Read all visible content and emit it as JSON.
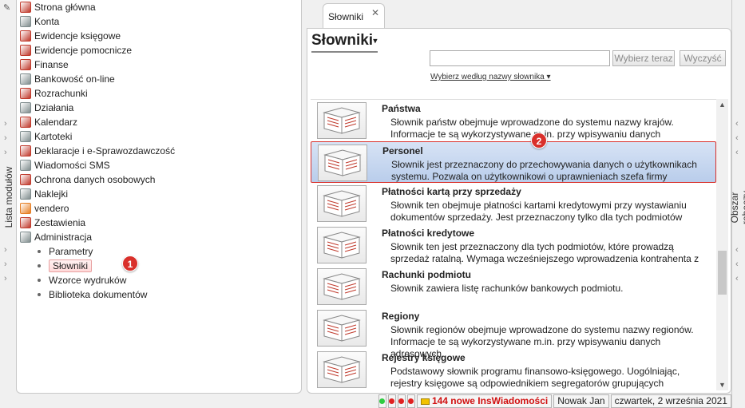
{
  "left_strip": {
    "label": "Lista modułów"
  },
  "tree": {
    "modules": [
      {
        "label": "Strona główna",
        "color": "#c0392b"
      },
      {
        "label": "Konta",
        "color": "#7f8c8d"
      },
      {
        "label": "Ewidencje księgowe",
        "color": "#c0392b"
      },
      {
        "label": "Ewidencje pomocnicze",
        "color": "#c0392b"
      },
      {
        "label": "Finanse",
        "color": "#c0392b"
      },
      {
        "label": "Bankowość on-line",
        "color": "#7f8c8d"
      },
      {
        "label": "Rozrachunki",
        "color": "#c0392b"
      },
      {
        "label": "Działania",
        "color": "#7f8c8d"
      },
      {
        "label": "Kalendarz",
        "color": "#c0392b"
      },
      {
        "label": "Kartoteki",
        "color": "#7f8c8d"
      },
      {
        "label": "Deklaracje i e-Sprawozdawczość",
        "color": "#c0392b"
      },
      {
        "label": "Wiadomości SMS",
        "color": "#7f8c8d"
      },
      {
        "label": "Ochrona danych osobowych",
        "color": "#c0392b"
      },
      {
        "label": "Naklejki",
        "color": "#7f8c8d"
      },
      {
        "label": "vendero",
        "color": "#e67e22"
      },
      {
        "label": "Zestawienia",
        "color": "#c0392b"
      },
      {
        "label": "Administracja",
        "color": "#7f8c8d"
      }
    ],
    "admin_children": [
      {
        "label": "Parametry"
      },
      {
        "label": "Słowniki"
      },
      {
        "label": "Wzorce wydruków"
      },
      {
        "label": "Biblioteka dokumentów"
      }
    ],
    "callout": "1"
  },
  "tab": {
    "label": "Słowniki",
    "close": "✕"
  },
  "main": {
    "title": "Słowniki",
    "title_caret": "▾",
    "search": {
      "value": "",
      "placeholder": ""
    },
    "choose_label": "Wybierz teraz",
    "clear_label": "Wyczyść",
    "filter_label": "Wybierz według nazwy słownika ▾",
    "callout": "2"
  },
  "dictionaries": [
    {
      "title": "Państwa",
      "desc": "Słownik państw obejmuje wprowadzone do systemu nazwy krajów. Informacje te są wykorzystywane m.in. przy wpisywaniu danych adresowych"
    },
    {
      "title": "Personel",
      "desc": "Słownik jest przeznaczony do przechowywania danych o użytkownikach systemu. Pozwala on użytkownikowi o uprawnieniach szefa firmy"
    },
    {
      "title": "Płatności kartą przy sprzedaży",
      "desc": "Słownik ten obejmuje płatności kartami kredytowymi przy wystawianiu dokumentów sprzedaży. Jest przeznaczony tylko dla tych podmiotów"
    },
    {
      "title": "Płatności kredytowe",
      "desc": "Słownik ten jest przeznaczony dla tych podmiotów, które prowadzą sprzedaż ratalną. Wymaga wcześniejszego wprowadzenia kontrahenta z"
    },
    {
      "title": "Rachunki podmiotu",
      "desc": "Słownik zawiera listę rachunków bankowych podmiotu."
    },
    {
      "title": "Regiony",
      "desc": "Słownik regionów obejmuje wprowadzone do systemu nazwy regionów. Informacje te są wykorzystywane m.in. przy wpisywaniu danych adresowych"
    },
    {
      "title": "Rejestry księgowe",
      "desc": "Podstawowy słownik programu finansowo-księgowego. Uogólniając, rejestry księgowe są odpowiednikiem segregatorów grupujących"
    }
  ],
  "right_strip": {
    "label": "Obszar roboczy"
  },
  "status": {
    "led_colors": [
      "#2ecc40",
      "#e02020",
      "#e02020",
      "#e02020"
    ],
    "messages": "144 nowe InsWiadomości",
    "user": "Nowak Jan",
    "date": "czwartek, 2 września 2021"
  },
  "colors": {
    "accent_red": "#d9302b",
    "selection_blue": "#c9d9f0"
  }
}
